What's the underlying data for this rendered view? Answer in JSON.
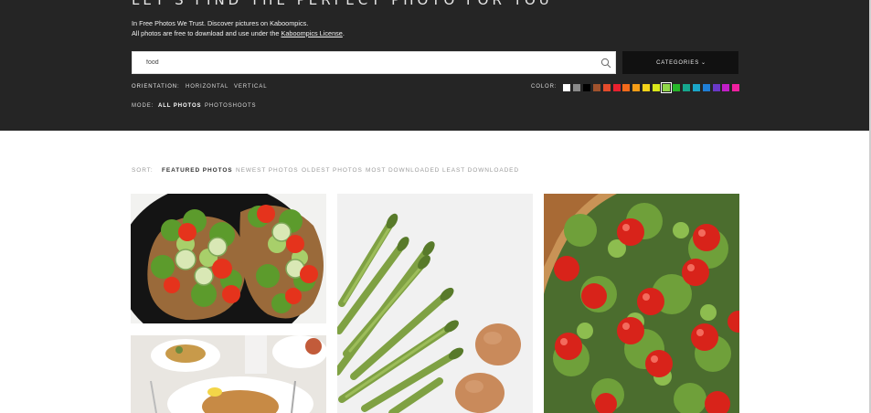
{
  "hero": {
    "title": "LET'S FIND THE PERFECT PHOTO FOR YOU",
    "tagline_1": "In Free Photos We Trust. Discover pictures on Kaboompics.",
    "tagline_2_prefix": "All photos are free to download and use under the",
    "tagline_2_link": "Kaboompics License",
    "tagline_2_suffix": "."
  },
  "search": {
    "value": "food",
    "icon": "search-icon"
  },
  "categories": {
    "label": "CATEGORIES",
    "icon": "chevron-down-icon"
  },
  "orientation": {
    "label": "ORIENTATION:",
    "options": [
      "HORIZONTAL",
      "VERTICAL"
    ]
  },
  "color": {
    "label": "COLOR:",
    "swatches": [
      "#ffffff",
      "#8a8a8a",
      "#000000",
      "#a0522d",
      "#e34b2c",
      "#e8212f",
      "#f26a1b",
      "#f59d17",
      "#f3d31a",
      "#d8e71b",
      "#92d74a",
      "#27b62a",
      "#16a78e",
      "#1ba6c9",
      "#1f7fd6",
      "#6a39c7",
      "#c21ec7",
      "#f020a0"
    ],
    "selected_index": 10
  },
  "mode": {
    "label": "MODE:",
    "options": [
      "ALL PHOTOS",
      "PHOTOSHOOTS"
    ],
    "active": "ALL PHOTOS"
  },
  "sort": {
    "label": "SORT:",
    "options": [
      "FEATURED PHOTOS",
      "NEWEST PHOTOS",
      "OLDEST PHOTOS",
      "MOST DOWNLOADED",
      "LEAST DOWNLOADED"
    ],
    "active": "FEATURED PHOTOS"
  },
  "photos": [
    {
      "subject": "toast-with-tomatoes-cucumber-lettuce"
    },
    {
      "subject": "asparagus-and-eggs"
    },
    {
      "subject": "pizza-with-arugula-and-cherry-tomatoes"
    },
    {
      "subject": "pasta-dinner-table"
    }
  ]
}
